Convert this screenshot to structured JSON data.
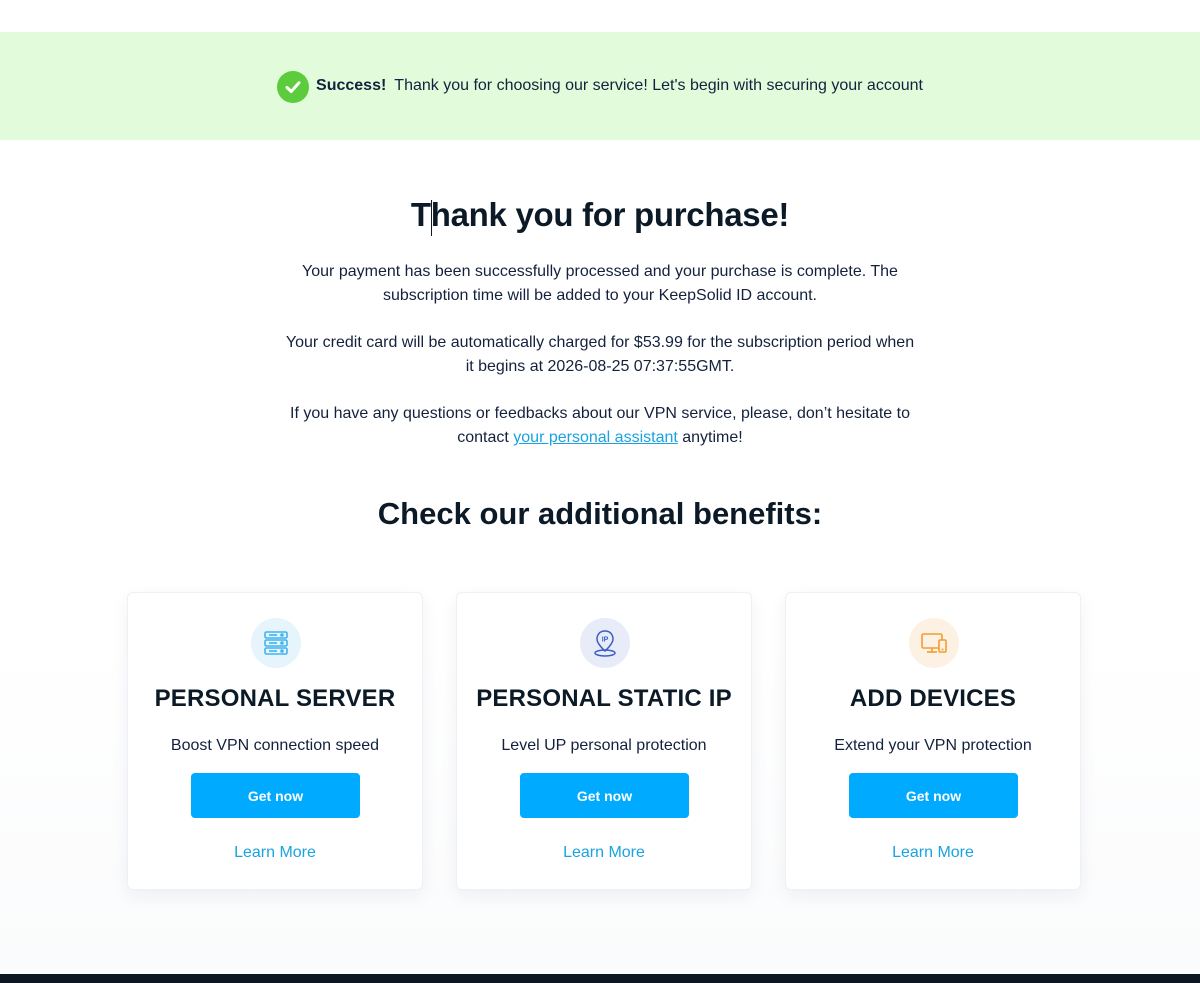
{
  "banner": {
    "strong": "Success!",
    "message": "Thank you for choosing our service! Let's begin with securing your account",
    "icon": "check-circle-icon",
    "bg_color": "#e2fbdb",
    "icon_color": "#5ccb3c"
  },
  "main": {
    "title": "Thank you for purchase!",
    "para1": "Your payment has been successfully processed and your purchase is complete. The subscription time will be added to your KeepSolid ID account.",
    "para2": "Your credit card will be automatically charged for $53.99 for the subscription period when it begins at 2026-08-25 07:37:55GMT.",
    "para3_before": "If you have any questions or feedbacks about our VPN service, please, don’t hesitate to contact ",
    "para3_link": "your personal assistant",
    "para3_after": " anytime!",
    "subtitle": "Check our additional benefits:"
  },
  "cards": [
    {
      "icon": "server-icon",
      "title": "PERSONAL SERVER",
      "description": "Boost VPN connection speed",
      "button": "Get now",
      "link": "Learn More",
      "icon_bg": "#e6f4fc",
      "icon_color": "#3fb3ee"
    },
    {
      "icon": "ip-location-pin-icon",
      "title": "PERSONAL STATIC IP",
      "description": "Level UP personal protection",
      "button": "Get now",
      "link": "Learn More",
      "icon_bg": "#e8ecf8",
      "icon_color": "#3a5fc4"
    },
    {
      "icon": "devices-icon",
      "title": "ADD DEVICES",
      "description": "Extend your VPN protection",
      "button": "Get now",
      "link": "Learn More",
      "icon_bg": "#fdf1e4",
      "icon_color": "#f29d2e"
    }
  ],
  "colors": {
    "accent": "#00aaff",
    "link": "#1aa3e0",
    "heading": "#0b1a26",
    "footer": "#0c1622"
  }
}
